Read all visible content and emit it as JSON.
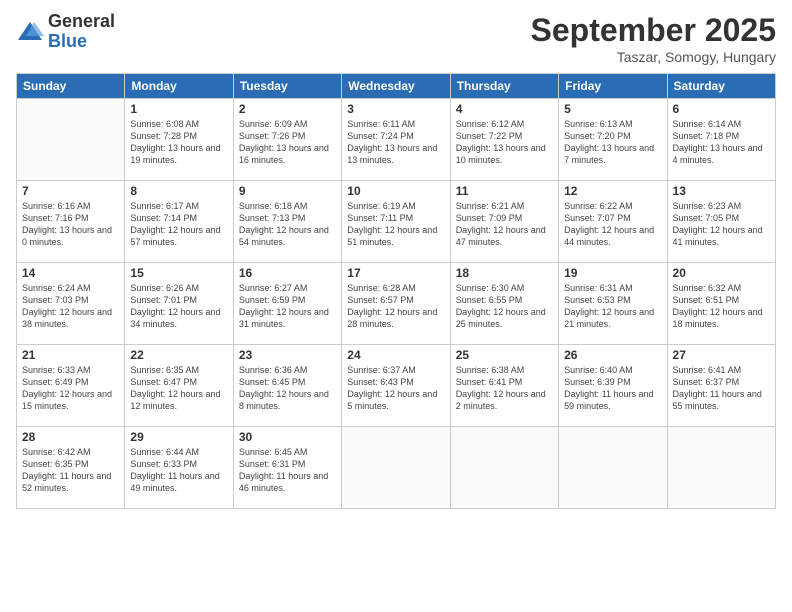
{
  "logo": {
    "general": "General",
    "blue": "Blue"
  },
  "title": "September 2025",
  "subtitle": "Taszar, Somogy, Hungary",
  "days_header": [
    "Sunday",
    "Monday",
    "Tuesday",
    "Wednesday",
    "Thursday",
    "Friday",
    "Saturday"
  ],
  "weeks": [
    [
      {
        "day": "",
        "sunrise": "",
        "sunset": "",
        "daylight": ""
      },
      {
        "day": "1",
        "sunrise": "Sunrise: 6:08 AM",
        "sunset": "Sunset: 7:28 PM",
        "daylight": "Daylight: 13 hours and 19 minutes."
      },
      {
        "day": "2",
        "sunrise": "Sunrise: 6:09 AM",
        "sunset": "Sunset: 7:26 PM",
        "daylight": "Daylight: 13 hours and 16 minutes."
      },
      {
        "day": "3",
        "sunrise": "Sunrise: 6:11 AM",
        "sunset": "Sunset: 7:24 PM",
        "daylight": "Daylight: 13 hours and 13 minutes."
      },
      {
        "day": "4",
        "sunrise": "Sunrise: 6:12 AM",
        "sunset": "Sunset: 7:22 PM",
        "daylight": "Daylight: 13 hours and 10 minutes."
      },
      {
        "day": "5",
        "sunrise": "Sunrise: 6:13 AM",
        "sunset": "Sunset: 7:20 PM",
        "daylight": "Daylight: 13 hours and 7 minutes."
      },
      {
        "day": "6",
        "sunrise": "Sunrise: 6:14 AM",
        "sunset": "Sunset: 7:18 PM",
        "daylight": "Daylight: 13 hours and 4 minutes."
      }
    ],
    [
      {
        "day": "7",
        "sunrise": "Sunrise: 6:16 AM",
        "sunset": "Sunset: 7:16 PM",
        "daylight": "Daylight: 13 hours and 0 minutes."
      },
      {
        "day": "8",
        "sunrise": "Sunrise: 6:17 AM",
        "sunset": "Sunset: 7:14 PM",
        "daylight": "Daylight: 12 hours and 57 minutes."
      },
      {
        "day": "9",
        "sunrise": "Sunrise: 6:18 AM",
        "sunset": "Sunset: 7:13 PM",
        "daylight": "Daylight: 12 hours and 54 minutes."
      },
      {
        "day": "10",
        "sunrise": "Sunrise: 6:19 AM",
        "sunset": "Sunset: 7:11 PM",
        "daylight": "Daylight: 12 hours and 51 minutes."
      },
      {
        "day": "11",
        "sunrise": "Sunrise: 6:21 AM",
        "sunset": "Sunset: 7:09 PM",
        "daylight": "Daylight: 12 hours and 47 minutes."
      },
      {
        "day": "12",
        "sunrise": "Sunrise: 6:22 AM",
        "sunset": "Sunset: 7:07 PM",
        "daylight": "Daylight: 12 hours and 44 minutes."
      },
      {
        "day": "13",
        "sunrise": "Sunrise: 6:23 AM",
        "sunset": "Sunset: 7:05 PM",
        "daylight": "Daylight: 12 hours and 41 minutes."
      }
    ],
    [
      {
        "day": "14",
        "sunrise": "Sunrise: 6:24 AM",
        "sunset": "Sunset: 7:03 PM",
        "daylight": "Daylight: 12 hours and 38 minutes."
      },
      {
        "day": "15",
        "sunrise": "Sunrise: 6:26 AM",
        "sunset": "Sunset: 7:01 PM",
        "daylight": "Daylight: 12 hours and 34 minutes."
      },
      {
        "day": "16",
        "sunrise": "Sunrise: 6:27 AM",
        "sunset": "Sunset: 6:59 PM",
        "daylight": "Daylight: 12 hours and 31 minutes."
      },
      {
        "day": "17",
        "sunrise": "Sunrise: 6:28 AM",
        "sunset": "Sunset: 6:57 PM",
        "daylight": "Daylight: 12 hours and 28 minutes."
      },
      {
        "day": "18",
        "sunrise": "Sunrise: 6:30 AM",
        "sunset": "Sunset: 6:55 PM",
        "daylight": "Daylight: 12 hours and 25 minutes."
      },
      {
        "day": "19",
        "sunrise": "Sunrise: 6:31 AM",
        "sunset": "Sunset: 6:53 PM",
        "daylight": "Daylight: 12 hours and 21 minutes."
      },
      {
        "day": "20",
        "sunrise": "Sunrise: 6:32 AM",
        "sunset": "Sunset: 6:51 PM",
        "daylight": "Daylight: 12 hours and 18 minutes."
      }
    ],
    [
      {
        "day": "21",
        "sunrise": "Sunrise: 6:33 AM",
        "sunset": "Sunset: 6:49 PM",
        "daylight": "Daylight: 12 hours and 15 minutes."
      },
      {
        "day": "22",
        "sunrise": "Sunrise: 6:35 AM",
        "sunset": "Sunset: 6:47 PM",
        "daylight": "Daylight: 12 hours and 12 minutes."
      },
      {
        "day": "23",
        "sunrise": "Sunrise: 6:36 AM",
        "sunset": "Sunset: 6:45 PM",
        "daylight": "Daylight: 12 hours and 8 minutes."
      },
      {
        "day": "24",
        "sunrise": "Sunrise: 6:37 AM",
        "sunset": "Sunset: 6:43 PM",
        "daylight": "Daylight: 12 hours and 5 minutes."
      },
      {
        "day": "25",
        "sunrise": "Sunrise: 6:38 AM",
        "sunset": "Sunset: 6:41 PM",
        "daylight": "Daylight: 12 hours and 2 minutes."
      },
      {
        "day": "26",
        "sunrise": "Sunrise: 6:40 AM",
        "sunset": "Sunset: 6:39 PM",
        "daylight": "Daylight: 11 hours and 59 minutes."
      },
      {
        "day": "27",
        "sunrise": "Sunrise: 6:41 AM",
        "sunset": "Sunset: 6:37 PM",
        "daylight": "Daylight: 11 hours and 55 minutes."
      }
    ],
    [
      {
        "day": "28",
        "sunrise": "Sunrise: 6:42 AM",
        "sunset": "Sunset: 6:35 PM",
        "daylight": "Daylight: 11 hours and 52 minutes."
      },
      {
        "day": "29",
        "sunrise": "Sunrise: 6:44 AM",
        "sunset": "Sunset: 6:33 PM",
        "daylight": "Daylight: 11 hours and 49 minutes."
      },
      {
        "day": "30",
        "sunrise": "Sunrise: 6:45 AM",
        "sunset": "Sunset: 6:31 PM",
        "daylight": "Daylight: 11 hours and 46 minutes."
      },
      {
        "day": "",
        "sunrise": "",
        "sunset": "",
        "daylight": ""
      },
      {
        "day": "",
        "sunrise": "",
        "sunset": "",
        "daylight": ""
      },
      {
        "day": "",
        "sunrise": "",
        "sunset": "",
        "daylight": ""
      },
      {
        "day": "",
        "sunrise": "",
        "sunset": "",
        "daylight": ""
      }
    ]
  ]
}
